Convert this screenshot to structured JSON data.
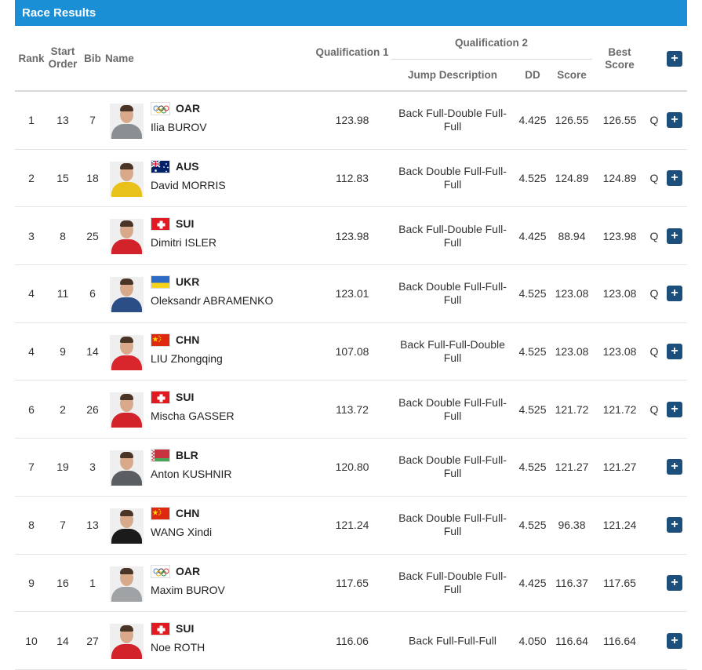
{
  "panel": {
    "title": "Race Results"
  },
  "header": {
    "rank": "Rank",
    "start_order": "Start Order",
    "bib": "Bib",
    "name": "Name",
    "qualification_1": "Qualification 1",
    "qualification_2": "Qualification 2",
    "jump_description": "Jump Description",
    "dd": "DD",
    "score": "Score",
    "best_score": "Best Score",
    "expand_all_icon": "plus-icon"
  },
  "colors": {
    "title_bar": "#1a8fd6",
    "expand_button": "#1c4f7c",
    "header_text": "#6a6a6a"
  },
  "rows": [
    {
      "rank": "1",
      "start_order": "13",
      "bib": "7",
      "noc": "OAR",
      "flag": "olympic-rings",
      "name": "Ilia BUROV",
      "q1": "123.98",
      "jump_description": "Back Full-Double Full-Full",
      "dd": "4.425",
      "score": "126.55",
      "best_score": "126.55",
      "qualified": "Q"
    },
    {
      "rank": "2",
      "start_order": "15",
      "bib": "18",
      "noc": "AUS",
      "flag": "australia",
      "name": "David MORRIS",
      "q1": "112.83",
      "jump_description": "Back Double Full-Full-Full",
      "dd": "4.525",
      "score": "124.89",
      "best_score": "124.89",
      "qualified": "Q"
    },
    {
      "rank": "3",
      "start_order": "8",
      "bib": "25",
      "noc": "SUI",
      "flag": "switzerland",
      "name": "Dimitri ISLER",
      "q1": "123.98",
      "jump_description": "Back Full-Double Full-Full",
      "dd": "4.425",
      "score": "88.94",
      "best_score": "123.98",
      "qualified": "Q"
    },
    {
      "rank": "4",
      "start_order": "11",
      "bib": "6",
      "noc": "UKR",
      "flag": "ukraine",
      "name": "Oleksandr ABRAMENKO",
      "q1": "123.01",
      "jump_description": "Back Double Full-Full-Full",
      "dd": "4.525",
      "score": "123.08",
      "best_score": "123.08",
      "qualified": "Q"
    },
    {
      "rank": "4",
      "start_order": "9",
      "bib": "14",
      "noc": "CHN",
      "flag": "china",
      "name": "LIU Zhongqing",
      "q1": "107.08",
      "jump_description": "Back Full-Full-Double Full",
      "dd": "4.525",
      "score": "123.08",
      "best_score": "123.08",
      "qualified": "Q"
    },
    {
      "rank": "6",
      "start_order": "2",
      "bib": "26",
      "noc": "SUI",
      "flag": "switzerland",
      "name": "Mischa GASSER",
      "q1": "113.72",
      "jump_description": "Back Double Full-Full-Full",
      "dd": "4.525",
      "score": "121.72",
      "best_score": "121.72",
      "qualified": "Q"
    },
    {
      "rank": "7",
      "start_order": "19",
      "bib": "3",
      "noc": "BLR",
      "flag": "belarus",
      "name": "Anton KUSHNIR",
      "q1": "120.80",
      "jump_description": "Back Double Full-Full-Full",
      "dd": "4.525",
      "score": "121.27",
      "best_score": "121.27",
      "qualified": ""
    },
    {
      "rank": "8",
      "start_order": "7",
      "bib": "13",
      "noc": "CHN",
      "flag": "china",
      "name": "WANG Xindi",
      "q1": "121.24",
      "jump_description": "Back Double Full-Full-Full",
      "dd": "4.525",
      "score": "96.38",
      "best_score": "121.24",
      "qualified": ""
    },
    {
      "rank": "9",
      "start_order": "16",
      "bib": "1",
      "noc": "OAR",
      "flag": "olympic-rings",
      "name": "Maxim BUROV",
      "q1": "117.65",
      "jump_description": "Back Full-Double Full-Full",
      "dd": "4.425",
      "score": "116.37",
      "best_score": "117.65",
      "qualified": ""
    },
    {
      "rank": "10",
      "start_order": "14",
      "bib": "27",
      "noc": "SUI",
      "flag": "switzerland",
      "name": "Noe ROTH",
      "q1": "116.06",
      "jump_description": "Back Full-Full-Full",
      "dd": "4.050",
      "score": "116.64",
      "best_score": "116.64",
      "qualified": ""
    }
  ]
}
